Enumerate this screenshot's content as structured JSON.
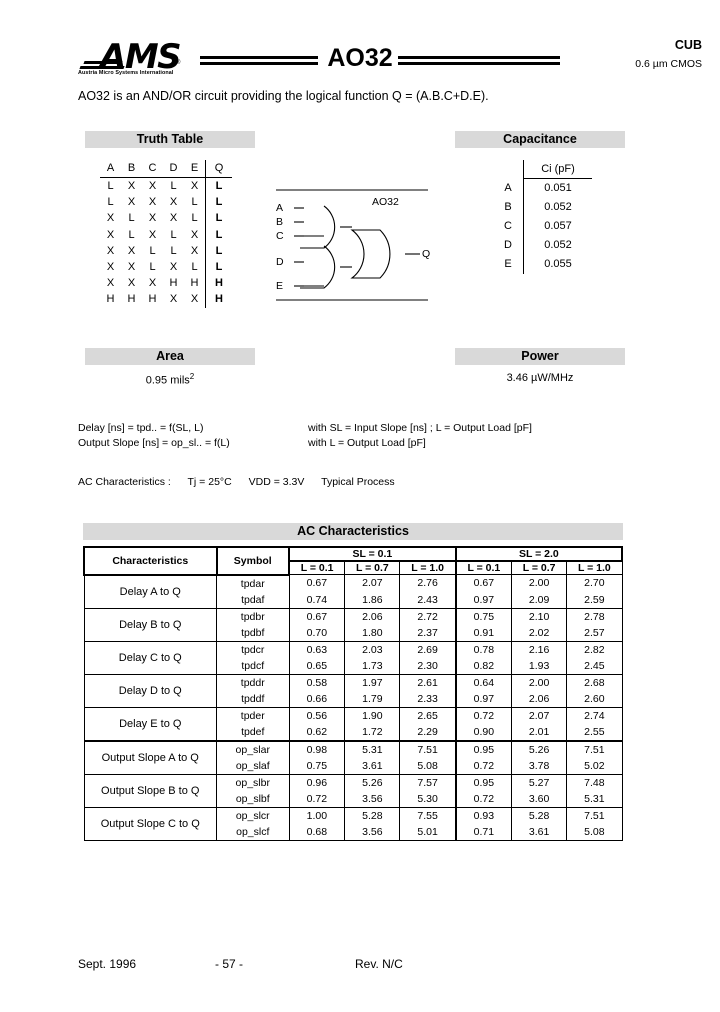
{
  "header": {
    "logo_mark": "AMS",
    "logo_registered": "®",
    "logo_subtitle": "Austria Micro Systems International",
    "part_title": "AO32",
    "family": "CUB",
    "process": "0.6 µm CMOS"
  },
  "intro": "AO32 is an AND/OR circuit providing the logical function Q = (A.B.C+D.E).",
  "sections": {
    "truth_table": "Truth Table",
    "capacitance": "Capacitance",
    "area": "Area",
    "power": "Power",
    "ac_characteristics": "AC Characteristics"
  },
  "truth_table": {
    "columns": [
      "A",
      "B",
      "C",
      "D",
      "E",
      "Q"
    ],
    "rows": [
      [
        "L",
        "X",
        "X",
        "L",
        "X",
        "L"
      ],
      [
        "L",
        "X",
        "X",
        "X",
        "L",
        "L"
      ],
      [
        "X",
        "L",
        "X",
        "X",
        "L",
        "L"
      ],
      [
        "X",
        "L",
        "X",
        "L",
        "X",
        "L"
      ],
      [
        "X",
        "X",
        "L",
        "L",
        "X",
        "L"
      ],
      [
        "X",
        "X",
        "L",
        "X",
        "L",
        "L"
      ],
      [
        "X",
        "X",
        "X",
        "H",
        "H",
        "H"
      ],
      [
        "H",
        "H",
        "H",
        "X",
        "X",
        "H"
      ]
    ]
  },
  "capacitance": {
    "value_header": "Ci (pF)",
    "rows": [
      {
        "pin": "A",
        "ci": "0.051"
      },
      {
        "pin": "B",
        "ci": "0.052"
      },
      {
        "pin": "C",
        "ci": "0.057"
      },
      {
        "pin": "D",
        "ci": "0.052"
      },
      {
        "pin": "E",
        "ci": "0.055"
      }
    ]
  },
  "area_value": "0.95  mils",
  "area_exp": "2",
  "power_value": "3.46 µW/MHz",
  "diagram": {
    "label": "AO32",
    "inputs": [
      "A",
      "B",
      "C",
      "D",
      "E"
    ],
    "output": "Q"
  },
  "notes": {
    "line1_left": "Delay [ns]  =  tpd..  =  f(SL, L)",
    "line1_right": "with  SL = Input Slope [ns] ;  L = Output Load [pF]",
    "line2_left": "Output Slope [ns]  =  op_sl..  =  f(L)",
    "line2_right": "with  L = Output Load [pF]",
    "ac_conditions_label": "AC Characteristics :",
    "ac_tj": "Tj = 25°C",
    "ac_vdd": "VDD = 3.3V",
    "ac_process": "Typical Process"
  },
  "ac_table": {
    "col_characteristics": "Characteristics",
    "col_symbol": "Symbol",
    "group_headers": [
      "SL = 0.1",
      "SL = 2.0"
    ],
    "load_headers": [
      "L = 0.1",
      "L = 0.7",
      "L = 1.0",
      "L = 0.1",
      "L = 0.7",
      "L = 1.0"
    ],
    "rows": [
      {
        "characteristic": "Delay A to Q",
        "symbol_rise": "tpdar",
        "symbol_fall": "tpdaf",
        "rise": [
          "0.67",
          "2.07",
          "2.76",
          "0.67",
          "2.00",
          "2.70"
        ],
        "fall": [
          "0.74",
          "1.86",
          "2.43",
          "0.97",
          "2.09",
          "2.59"
        ]
      },
      {
        "characteristic": "Delay B to Q",
        "symbol_rise": "tpdbr",
        "symbol_fall": "tpdbf",
        "rise": [
          "0.67",
          "2.06",
          "2.72",
          "0.75",
          "2.10",
          "2.78"
        ],
        "fall": [
          "0.70",
          "1.80",
          "2.37",
          "0.91",
          "2.02",
          "2.57"
        ]
      },
      {
        "characteristic": "Delay C to Q",
        "symbol_rise": "tpdcr",
        "symbol_fall": "tpdcf",
        "rise": [
          "0.63",
          "2.03",
          "2.69",
          "0.78",
          "2.16",
          "2.82"
        ],
        "fall": [
          "0.65",
          "1.73",
          "2.30",
          "0.82",
          "1.93",
          "2.45"
        ]
      },
      {
        "characteristic": "Delay D to Q",
        "symbol_rise": "tpddr",
        "symbol_fall": "tpddf",
        "rise": [
          "0.58",
          "1.97",
          "2.61",
          "0.64",
          "2.00",
          "2.68"
        ],
        "fall": [
          "0.66",
          "1.79",
          "2.33",
          "0.97",
          "2.06",
          "2.60"
        ]
      },
      {
        "characteristic": "Delay E to Q",
        "symbol_rise": "tpder",
        "symbol_fall": "tpdef",
        "rise": [
          "0.56",
          "1.90",
          "2.65",
          "0.72",
          "2.07",
          "2.74"
        ],
        "fall": [
          "0.62",
          "1.72",
          "2.29",
          "0.90",
          "2.01",
          "2.55"
        ]
      },
      {
        "characteristic": "Output Slope A to Q",
        "symbol_rise": "op_slar",
        "symbol_fall": "op_slaf",
        "rise": [
          "0.98",
          "5.31",
          "7.51",
          "0.95",
          "5.26",
          "7.51"
        ],
        "fall": [
          "0.75",
          "3.61",
          "5.08",
          "0.72",
          "3.78",
          "5.02"
        ]
      },
      {
        "characteristic": "Output Slope B to Q",
        "symbol_rise": "op_slbr",
        "symbol_fall": "op_slbf",
        "rise": [
          "0.96",
          "5.26",
          "7.57",
          "0.95",
          "5.27",
          "7.48"
        ],
        "fall": [
          "0.72",
          "3.56",
          "5.30",
          "0.72",
          "3.60",
          "5.31"
        ]
      },
      {
        "characteristic": "Output Slope C to Q",
        "symbol_rise": "op_slcr",
        "symbol_fall": "op_slcf",
        "rise": [
          "1.00",
          "5.28",
          "7.55",
          "0.93",
          "5.28",
          "7.51"
        ],
        "fall": [
          "0.68",
          "3.56",
          "5.01",
          "0.71",
          "3.61",
          "5.08"
        ]
      }
    ]
  },
  "footer": {
    "date": "Sept. 1996",
    "page": "- 57 -",
    "revision": "Rev. N/C"
  }
}
